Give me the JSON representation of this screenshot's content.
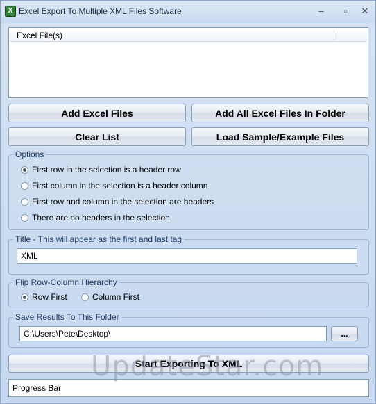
{
  "window": {
    "title": "Excel Export To Multiple XML Files Software",
    "minimize_glyph": "–",
    "maximize_glyph": "▫",
    "close_glyph": "✕"
  },
  "file_list": {
    "column_header": "Excel File(s)"
  },
  "buttons": {
    "add_excel_files": "Add Excel Files",
    "add_all_in_folder": "Add All Excel Files In Folder",
    "clear_list": "Clear List",
    "load_sample": "Load Sample/Example Files",
    "browse": "...",
    "start_export": "Start Exporting To XML"
  },
  "options": {
    "title": "Options",
    "items": [
      {
        "label": "First row in the selection is a header row",
        "selected": true
      },
      {
        "label": "First column in the selection is a header column",
        "selected": false
      },
      {
        "label": "First row and column in the selection are headers",
        "selected": false
      },
      {
        "label": "There are no headers in the selection",
        "selected": false
      }
    ]
  },
  "title_group": {
    "title": "Title - This will appear as the first and last tag",
    "value": "XML"
  },
  "hierarchy": {
    "title": "Flip Row-Column Hierarchy",
    "items": [
      {
        "label": "Row First",
        "selected": true
      },
      {
        "label": "Column First",
        "selected": false
      }
    ]
  },
  "save": {
    "title": "Save Results To This Folder",
    "value": "C:\\Users\\Pete\\Desktop\\"
  },
  "progress": {
    "label": "Progress Bar"
  },
  "watermark": "UpdateStar.com"
}
